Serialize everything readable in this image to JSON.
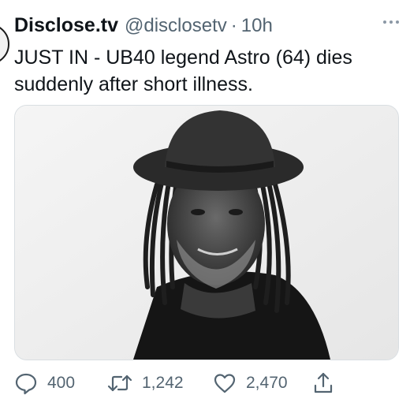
{
  "tweet": {
    "display_name": "Disclose.tv",
    "handle": "@disclosetv",
    "separator": "·",
    "time": "10h",
    "text": "JUST IN - UB40 legend Astro (64) dies suddenly after short illness."
  },
  "media": {
    "description_icon": "photo-portrait"
  },
  "actions": {
    "reply_count": "400",
    "retweet_count": "1,242",
    "like_count": "2,470"
  },
  "icons": {
    "reply": "speech-bubble-icon",
    "retweet": "retweet-arrows-icon",
    "like": "heart-icon",
    "share": "share-upload-icon",
    "more": "more-dots-icon"
  },
  "colors": {
    "text_primary": "#0f1419",
    "text_secondary": "#536471"
  }
}
